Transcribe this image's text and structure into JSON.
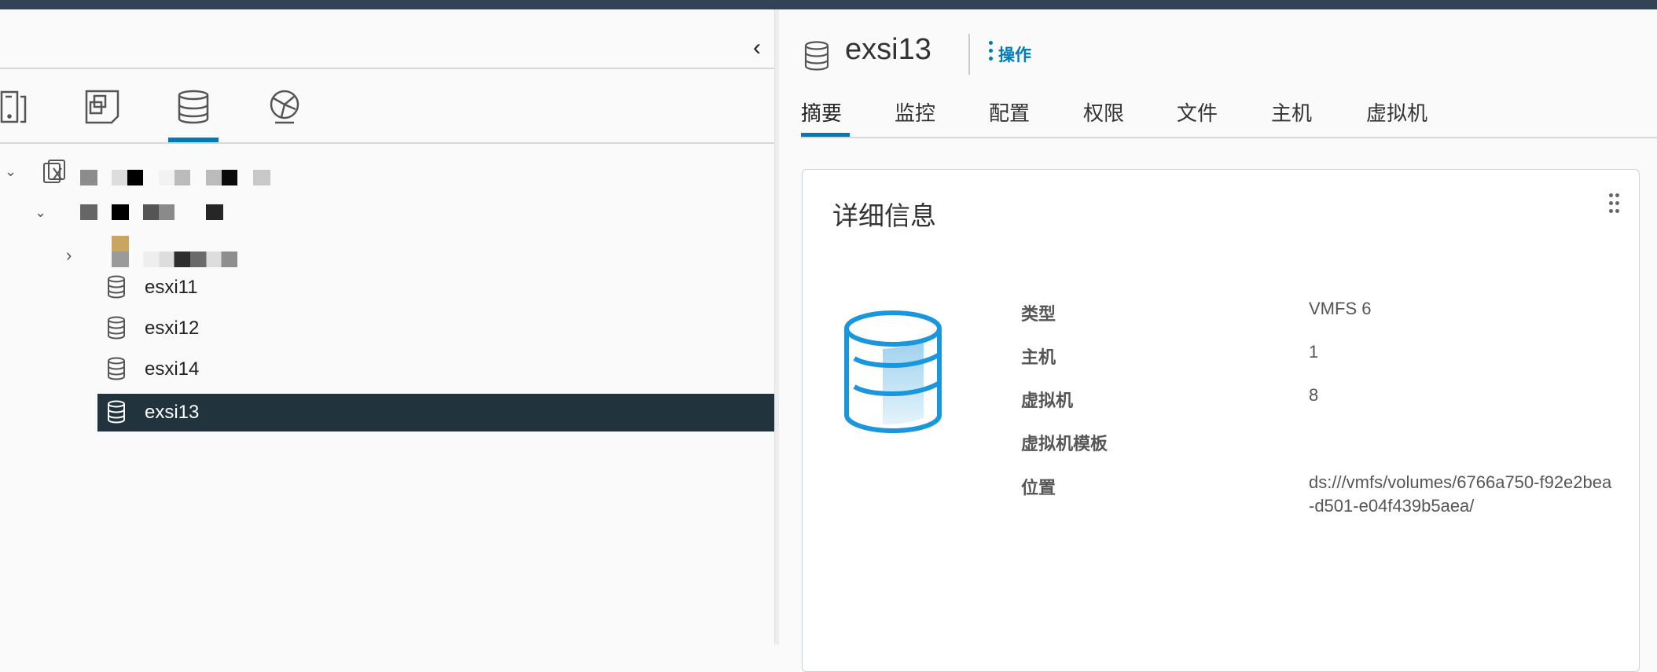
{
  "nav": {
    "collapse_icon": "chevron-left-icon",
    "icon_tabs": [
      {
        "icon": "hosts-and-clusters-icon",
        "active": false
      },
      {
        "icon": "vms-and-templates-icon",
        "active": false
      },
      {
        "icon": "storage-icon",
        "active": true
      },
      {
        "icon": "networking-icon",
        "active": false
      }
    ]
  },
  "tree": {
    "items": [
      {
        "label": "esxi11"
      },
      {
        "label": "esxi12"
      },
      {
        "label": "esxi14"
      },
      {
        "label": "exsi13",
        "selected": true
      }
    ]
  },
  "header": {
    "title": "exsi13",
    "actions_label": "操作"
  },
  "tabs": [
    {
      "label": "摘要",
      "active": true
    },
    {
      "label": "监控"
    },
    {
      "label": "配置"
    },
    {
      "label": "权限"
    },
    {
      "label": "文件"
    },
    {
      "label": "主机"
    },
    {
      "label": "虚拟机"
    }
  ],
  "details": {
    "title": "详细信息",
    "rows": [
      {
        "label": "类型",
        "value": "VMFS 6"
      },
      {
        "label": "主机",
        "value": "1"
      },
      {
        "label": "虚拟机",
        "value": "8"
      },
      {
        "label": "虚拟机模板",
        "value": ""
      },
      {
        "label": "位置",
        "value": "ds:///vmfs/volumes/6766a750-f92e2bea-d501-e04f439b5aea/"
      }
    ]
  },
  "colors": {
    "accent": "#0079b8",
    "topbar": "#314354",
    "selected_row": "#21333c"
  }
}
